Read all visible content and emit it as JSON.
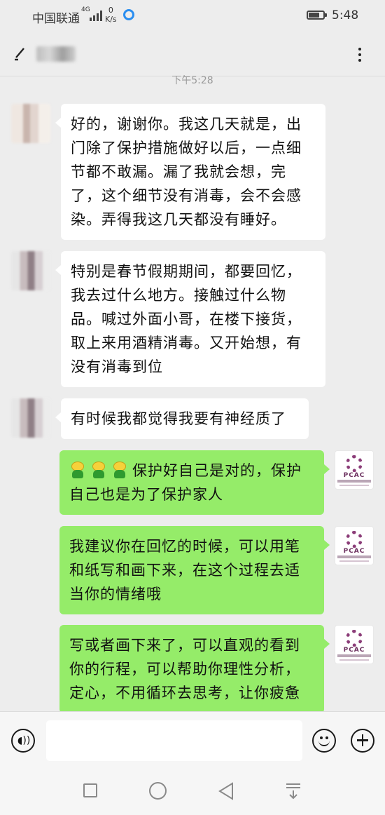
{
  "status_bar": {
    "carrier": "中国联通",
    "network": "4G",
    "speed_value": "0",
    "speed_unit": "K/s",
    "time": "5:48",
    "battery_level": 0.75
  },
  "header": {
    "back_icon": "back-arrow-icon",
    "more_icon": "more-dots-icon"
  },
  "chat": {
    "timestamp": "下午5:28",
    "messages": [
      {
        "direction": "in",
        "text": "好的，谢谢你。我这几天就是，出门除了保护措施做好以后，一点细节都不敢漏。漏了我就会想，完了，这个细节没有消毒，会不会感染。弄得我这几天都没有睡好。"
      },
      {
        "direction": "in",
        "text": "特别是春节假期期间，都要回忆，我去过什么地方。接触过什么物品。喊过外面小哥，在楼下接货，取上来用酒精消毒。又开始想，有没有消毒到位"
      },
      {
        "direction": "in",
        "text": "有时候我都觉得我要有神经质了"
      },
      {
        "direction": "out",
        "emoji_count": 3,
        "text": "保护好自己是对的，保护自己也是为了保护家人"
      },
      {
        "direction": "out",
        "text": "我建议你在回忆的时候，可以用笔和纸写和画下来，在这个过程去适当你的情绪哦"
      },
      {
        "direction": "out",
        "text": "写或者画下来了，可以直观的看到你的行程，可以帮助你理性分析，定心，不用循环去思考，让你疲惫"
      }
    ],
    "agent_avatar_label": "PCAC"
  },
  "input_bar": {
    "voice_icon": "voice-icon",
    "emoji_icon": "emoji-icon",
    "plus_icon": "plus-icon",
    "input_value": ""
  },
  "colors": {
    "outgoing_bubble": "#95ec69",
    "incoming_bubble": "#ffffff",
    "background": "#ededed"
  }
}
